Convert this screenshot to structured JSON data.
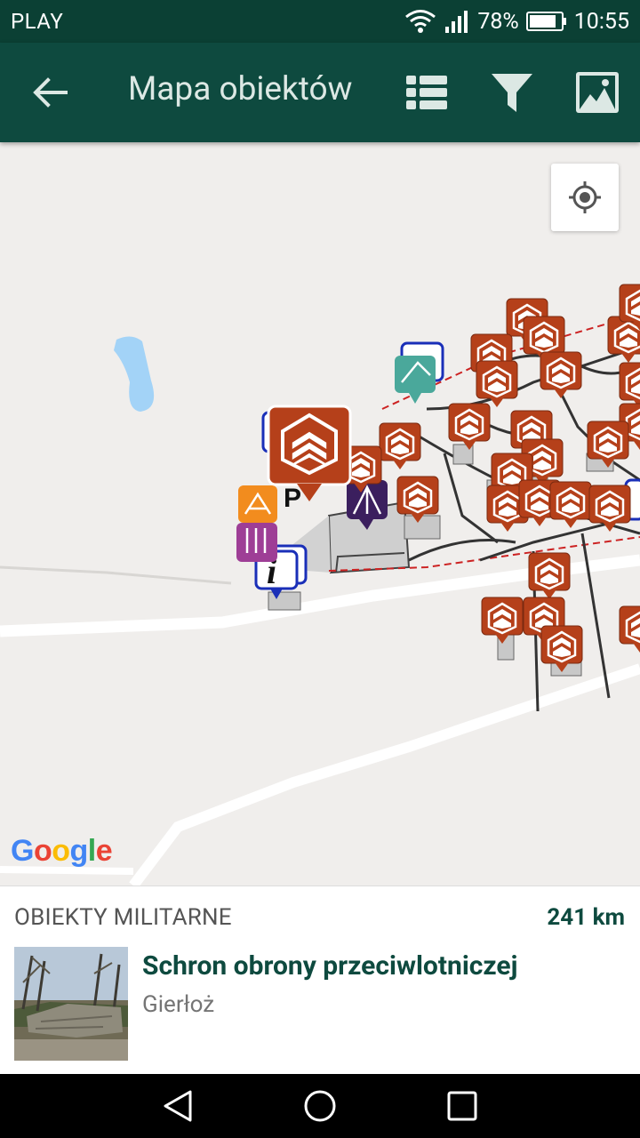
{
  "status_bar": {
    "carrier": "PLAY",
    "battery": "78%",
    "time": "10:55"
  },
  "app_bar": {
    "title": "Mapa obiektów",
    "icons": [
      "back-arrow-icon",
      "list-icon",
      "filter-icon",
      "image-icon"
    ]
  },
  "map": {
    "attribution": "Google",
    "parking_label": "P",
    "colors": {
      "military": "#b5401a",
      "info": "#1a2fb8",
      "background": "#f0eeec",
      "water": "#a3d3f7"
    }
  },
  "selected_object": {
    "category": "OBIEKTY MILITARNE",
    "distance": "241 km",
    "name": "Schron obrony przeciwlotniczej",
    "location": "Gierłoż"
  }
}
